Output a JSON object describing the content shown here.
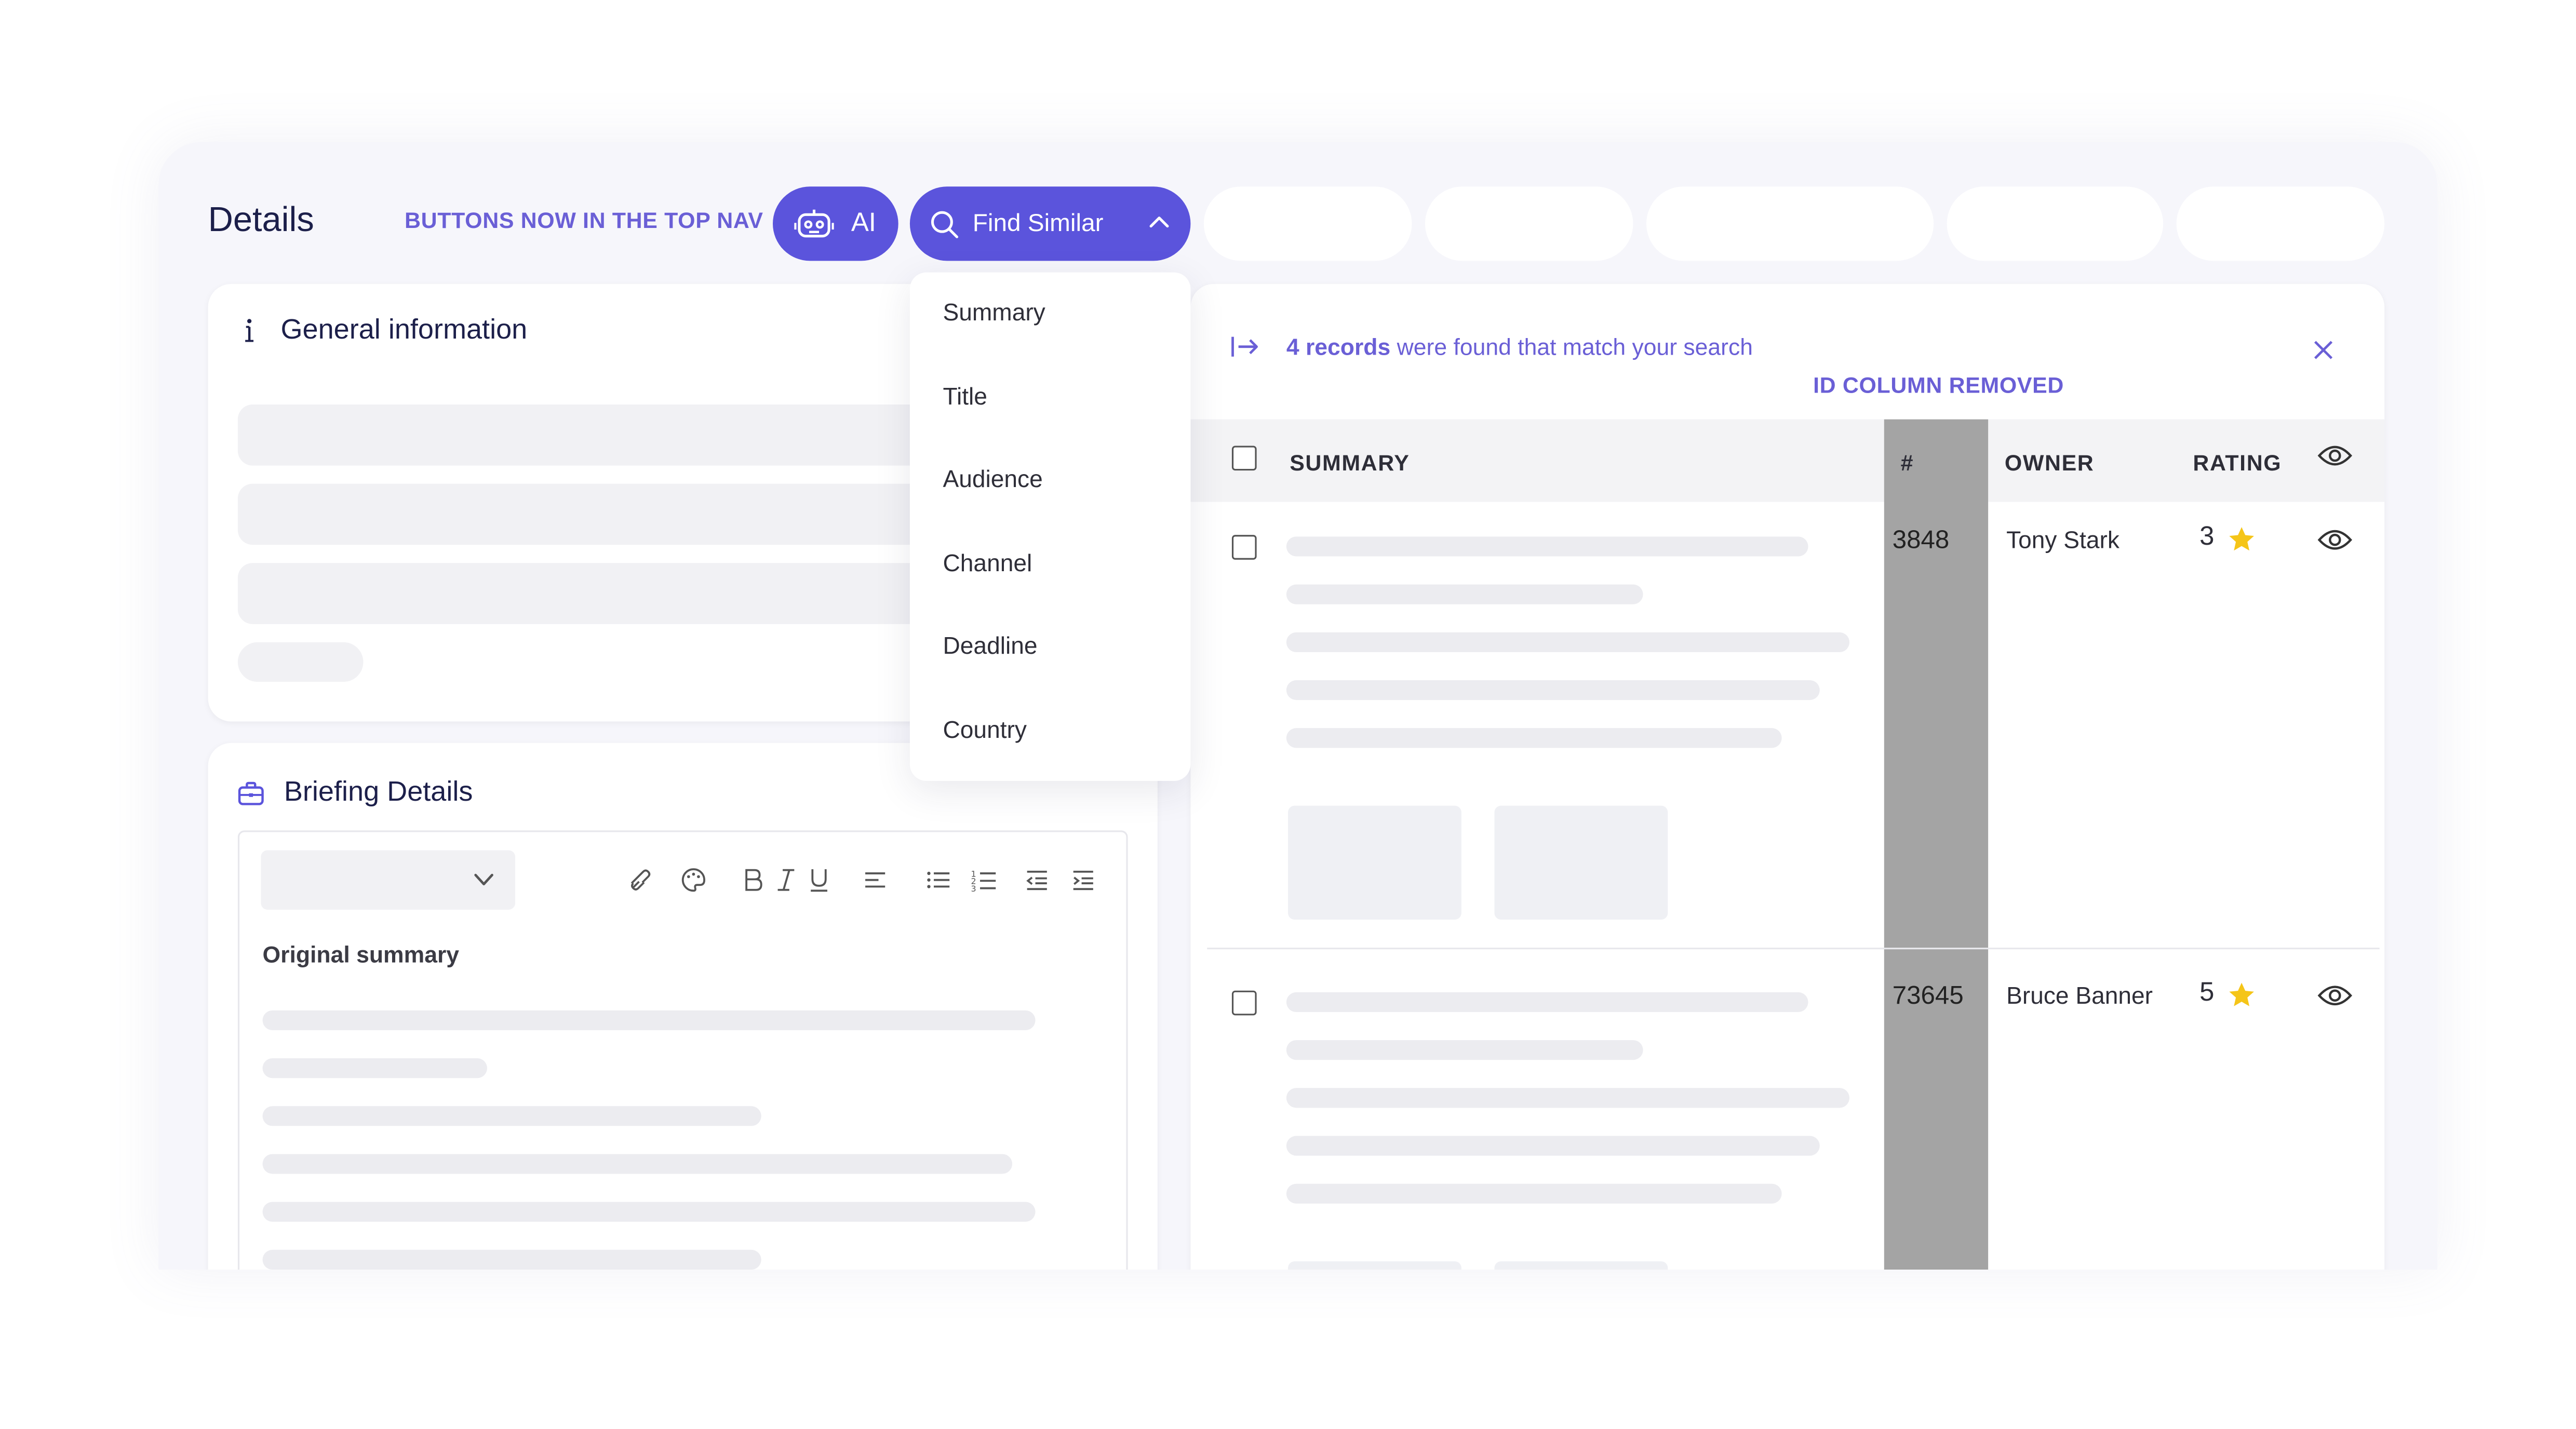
{
  "header": {
    "title": "Details",
    "annotation_nav": "BUTTONS NOW IN THE TOP NAV",
    "ai_button": {
      "label": "AI",
      "icon": "robot-icon"
    },
    "find_similar": {
      "label": "Find Similar",
      "icon": "search-icon",
      "state": "expanded"
    }
  },
  "general": {
    "title": "General information",
    "icon": "info-icon"
  },
  "briefing": {
    "title": "Briefing Details",
    "icon": "briefcase-icon",
    "editor": {
      "heading": "Original summary",
      "toolbar": [
        "link-icon",
        "palette-icon",
        "bold-icon",
        "italic-icon",
        "underline-icon",
        "align-left-icon",
        "bullet-list-icon",
        "numbered-list-icon",
        "outdent-icon",
        "indent-icon"
      ]
    }
  },
  "dropdown": {
    "items": [
      "Summary",
      "Title",
      "Audience",
      "Channel",
      "Deadline",
      "Country"
    ]
  },
  "results": {
    "count_label": "4 records",
    "message": " were found that match your search",
    "annotation_id": "ID COLUMN REMOVED",
    "columns": {
      "summary": "SUMMARY",
      "hash": "#",
      "owner": "OWNER",
      "rating": "RATING"
    },
    "rows": [
      {
        "number": "3848",
        "owner": "Tony Stark",
        "rating": "3"
      },
      {
        "number": "73645",
        "owner": "Bruce Banner",
        "rating": "5"
      }
    ]
  },
  "colors": {
    "accent": "#5b54dc",
    "annotation": "#6a5fd6",
    "star": "#f5c518",
    "highlight_column": "#a4a4a4"
  }
}
